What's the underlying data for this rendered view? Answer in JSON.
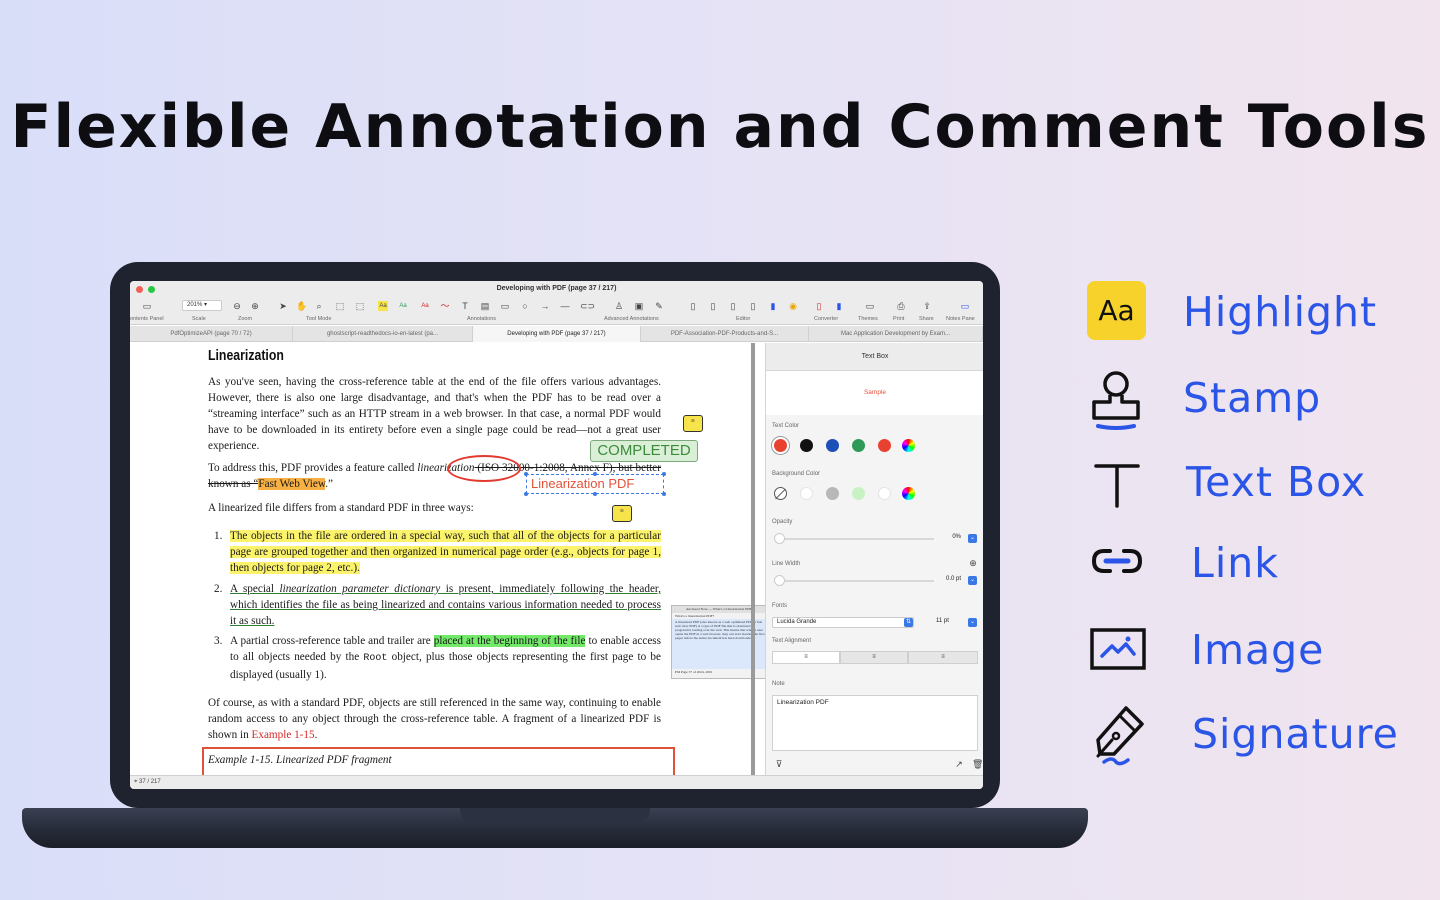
{
  "headline": "Flexible Annotation and Comment Tools",
  "window": {
    "title": "Developing with PDF (page 37 / 217)",
    "zoom": "201%",
    "toolbar_labels": [
      "ontents Panel",
      "Scale",
      "Zoom",
      "Tool Mode",
      "Annotations",
      "Advanced Annotations",
      "Editor",
      "Converter",
      "Themes",
      "Print",
      "Share",
      "Notes Pane"
    ],
    "tabs": [
      "PdfOptimizeAPI (page 70 / 72)",
      "ghostscript-readthedocs-io-en-latest (pa...",
      "Developing with PDF (page 37 / 217)",
      "PDF-Association-PDF-Products-and-S...",
      "Mac Application Development by Exam..."
    ],
    "status": "37 / 217"
  },
  "document": {
    "heading": "Linearization",
    "p1": "As you've seen, having the cross-reference table at the end of the file offers various advantages. However, there is also one large disadvantage, and that's when the PDF has to be read over a “streaming interface” such as an HTTP stream in a web browser. In that case, a normal PDF would have to be downloaded in its entirety before even a single page could be read—not a great user experience.",
    "p2a": "To address this, PDF provides a feature called ",
    "p2_italic": "linearization",
    "p2b": " (ISO 32000-1:2008, Annex F), but better known as “",
    "p2_hl": "Fast Web View",
    "p2c": ".”",
    "p3": "A linearized file differs from a standard PDF in three ways:",
    "li1": "The objects in the file are ordered in a special way, such that all of the objects for a particular page are grouped together and then organized in numerical page order (e.g., objects for page 1, then objects for page 2, etc.).",
    "li2a": "A special ",
    "li2_italic": "linearization parameter dictionary",
    "li2b": " is present, immediately following the header, which identifies the file as being linearized and contains various information needed to process it as such.",
    "li3a": "A partial cross-reference table and trailer are ",
    "li3_hl": "placed at the beginning of the file",
    "li3b": " to enable access to all objects needed by the ",
    "li3_code": "Root",
    "li3c": " object, plus those objects representing the first page to be displayed (usually 1).",
    "p4a": "Of course, as with a standard PDF, objects are still referenced in the same way, continuing to enable random access to any object through the cross-reference table. A fragment of a linearized PDF is shown in ",
    "p4_link": "Example 1-15",
    "p4b": ".",
    "caption": "Example 1-15. Linearized PDF fragment",
    "stamp": "COMPLETED",
    "textbox": "Linearization PDF",
    "list_nums": [
      "1.",
      "2.",
      "3."
    ]
  },
  "popup": {
    "title": "Anchored Note — What's a Linearization PDF?",
    "q": "What's a linearization PDF?",
    "body": "A linearized PDF (also known as a web optimized PDF or fast web view PDF) is a type of PDF file that is structured for progressive loading over the web. This means that when a user opens the PDF in a web browser, they can start viewing the first pages before the entire document has been downloaded.",
    "footer": "PM Page 37 of 2024, 2001"
  },
  "panel": {
    "title": "Text Box",
    "sample": "Sample",
    "text_color_label": "Text Color",
    "text_colors": [
      "#e8412f",
      "#111111",
      "#1d4fb8",
      "#2f9a58",
      "#e8412f"
    ],
    "bg_color_label": "Background Color",
    "bg_colors": [
      "#ffffff",
      "#b8b8b8",
      "#c9f2c4",
      "#ffffff"
    ],
    "opacity_label": "Opacity",
    "opacity_value": "0%",
    "opacity": 0,
    "line_width_label": "Line Width",
    "line_width_value": "0.0 pt",
    "line_width": 0,
    "fonts_label": "Fonts",
    "font_name": "Lucida Grande",
    "font_size": "11 pt",
    "alignment_label": "Text Alignment",
    "note_label": "Note",
    "note_text": "Linearization PDF"
  },
  "features": [
    {
      "icon": "highlight-icon",
      "label": "Highlight",
      "glyph": "Aa"
    },
    {
      "icon": "stamp-icon",
      "label": "Stamp"
    },
    {
      "icon": "text-box-icon",
      "label": "Text Box"
    },
    {
      "icon": "link-icon",
      "label": "Link"
    },
    {
      "icon": "image-icon",
      "label": "Image"
    },
    {
      "icon": "signature-icon",
      "label": "Signature"
    }
  ],
  "colors": {
    "accent": "#2b55e6",
    "highlight_badge": "#f7d22a"
  }
}
